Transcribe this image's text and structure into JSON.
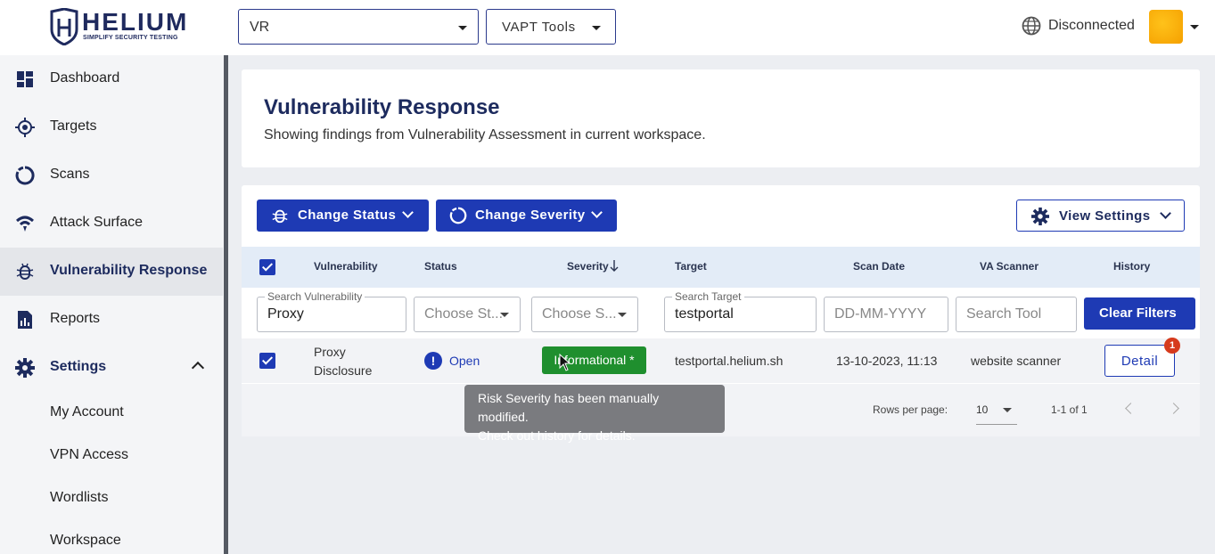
{
  "brand": {
    "name": "HELIUM",
    "tagline": "SIMPLIFY SECURITY TESTING"
  },
  "topbar": {
    "workspace": "VR",
    "tools": "VAPT Tools",
    "connection": "Disconnected"
  },
  "sidebar": {
    "items": [
      {
        "label": "Dashboard",
        "icon": "dashboard-icon"
      },
      {
        "label": "Targets",
        "icon": "target-icon"
      },
      {
        "label": "Scans",
        "icon": "scans-icon"
      },
      {
        "label": "Attack Surface",
        "icon": "attack-surface-icon"
      },
      {
        "label": "Vulnerability Response",
        "icon": "bug-icon",
        "active": true
      },
      {
        "label": "Reports",
        "icon": "reports-icon"
      },
      {
        "label": "Settings",
        "icon": "gear-icon",
        "expanded": true
      }
    ],
    "settings_sub": [
      "My Account",
      "VPN Access",
      "Wordlists",
      "Workspace"
    ]
  },
  "page": {
    "title": "Vulnerability Response",
    "subtitle": "Showing findings from Vulnerability Assessment in current workspace."
  },
  "toolbar": {
    "change_status": "Change Status",
    "change_severity": "Change Severity",
    "view_settings": "View Settings"
  },
  "table": {
    "columns": [
      "Vulnerability",
      "Status",
      "Severity",
      "Target",
      "Scan Date",
      "VA Scanner",
      "History"
    ],
    "filters": {
      "vulnerability_legend": "Search Vulnerability",
      "vulnerability_value": "Proxy",
      "status_placeholder": "Choose St...",
      "severity_placeholder": "Choose S...",
      "target_legend": "Search Target",
      "target_value": "testportal",
      "date_placeholder": "DD-MM-YYYY",
      "tool_placeholder": "Search Tool",
      "clear": "Clear Filters"
    },
    "rows": [
      {
        "vulnerability": "Proxy Disclosure",
        "status": "Open",
        "status_icon": "!",
        "severity": "Informational *",
        "target": "testportal.helium.sh",
        "scan_date": "13-10-2023, 11:13",
        "scanner": "website scanner",
        "history": "Detail",
        "history_count": "1"
      }
    ],
    "pagination": {
      "rows_per_page_label": "Rows per page:",
      "rows_per_page": "10",
      "range": "1-1 of 1"
    }
  },
  "tooltip": {
    "line1": "Risk Severity has been manually modified.",
    "line2": "Check out history for details."
  },
  "colors": {
    "primary": "#1e3ab4",
    "severity_informational": "#1f8f2e",
    "badge": "#d63a1c",
    "brand": "#1f2a5e"
  }
}
